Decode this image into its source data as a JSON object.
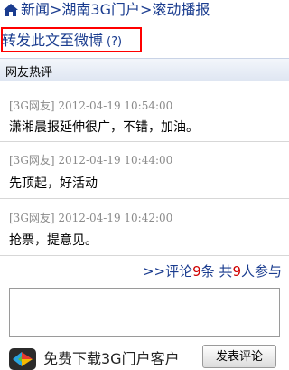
{
  "breadcrumb": {
    "home_icon": "home-icon",
    "items": [
      "新闻",
      "湖南3G门户",
      "滚动播报"
    ],
    "separator": ">"
  },
  "share": {
    "label": "转发此文至微博",
    "help": "(?)"
  },
  "section": {
    "title": "网友热评"
  },
  "comments": [
    {
      "meta": "[3G网友] 2012-04-19 10:54:00",
      "text": "潇湘晨报延伸很广，不错，加油。"
    },
    {
      "meta": "[3G网友] 2012-04-19 10:44:00",
      "text": "先顶起，好活动"
    },
    {
      "meta": "[3G网友] 2012-04-19 10:42:00",
      "text": "抢票，提意见。"
    }
  ],
  "summary": {
    "prefix": ">>评论",
    "comment_count": "9",
    "middle": "条 共",
    "participant_count": "9",
    "suffix": "人参与"
  },
  "input": {
    "value": "",
    "placeholder": ""
  },
  "footer": {
    "download_label": "免费下载3G门户客户",
    "post_button": "发表评论"
  },
  "colors": {
    "link": "#1a3c8f",
    "highlight_border": "#ff0000",
    "count": "#d00000"
  }
}
